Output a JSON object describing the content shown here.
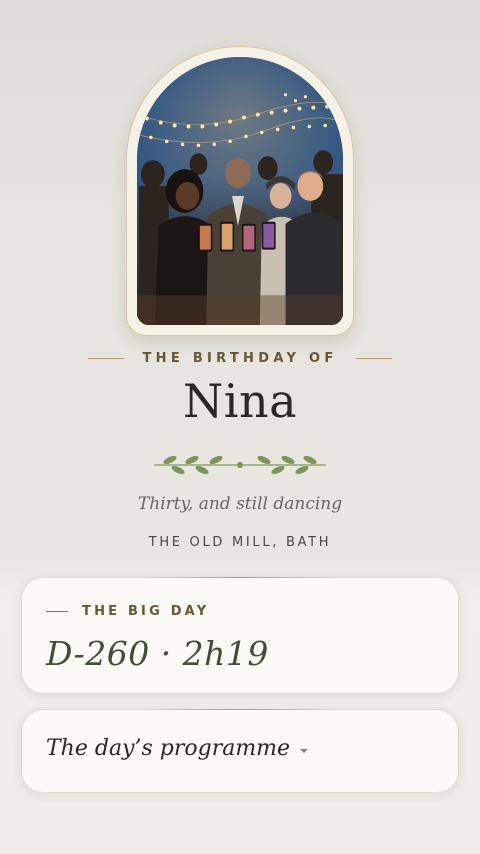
{
  "hero": {
    "eyebrow": "THE BIRTHDAY OF",
    "name": "Nina",
    "tagline": "Thirty, and still dancing",
    "venue": "THE OLD MILL, BATH"
  },
  "countdown_card": {
    "label": "THE BIG DAY",
    "value": "D-260 · 2h19"
  },
  "programme_card": {
    "title": "The day’s programme",
    "icon": "chevron-down-icon"
  },
  "colors": {
    "accent_gold": "#b79a67",
    "label_brown": "#6a5632",
    "countdown_green": "#3f4e36",
    "laurel_green": "#7d9657",
    "card_bg": "#fbfaf6"
  },
  "icons": {
    "photo": "party-photo",
    "divider": "laurel-divider-icon"
  }
}
